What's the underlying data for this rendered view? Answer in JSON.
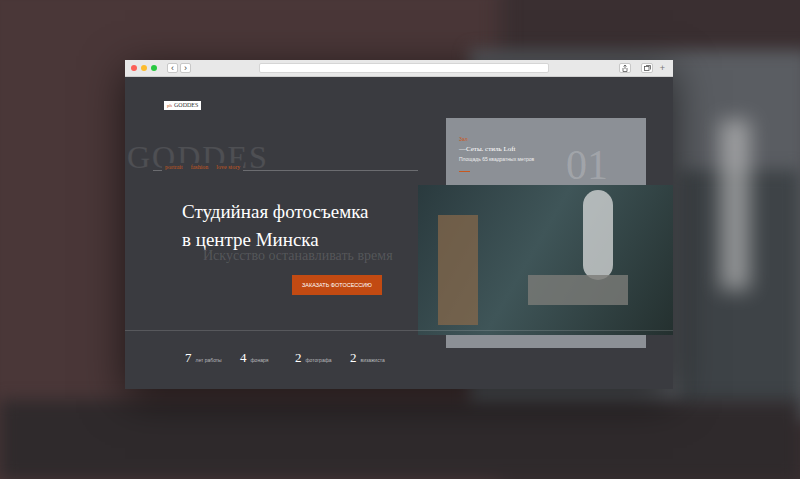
{
  "browser": {
    "back": "‹",
    "forward": "›",
    "new_tab": "+"
  },
  "site": {
    "logo_mark": "ph",
    "logo": "GODDES",
    "watermark": "GODDES",
    "nav": [
      {
        "label": "portrait"
      },
      {
        "label": "fashion"
      },
      {
        "label": "love story"
      }
    ],
    "headline_lines": [
      "Студийная фотосъемка",
      "в центре Минска"
    ],
    "tagline": "Искусство останавливать время",
    "cta": "ЗАКАЗАТЬ ФОТОСЕССИЮ",
    "feature": {
      "kicker": "Зал",
      "title": "—Сеты. стиль Loft",
      "detail": "Площадь 65 квадратных метров",
      "number": "01"
    },
    "stats": [
      {
        "value": "7",
        "label": "лет работы"
      },
      {
        "value": "4",
        "label": "фонаря"
      },
      {
        "value": "2",
        "label": "фотографа"
      },
      {
        "value": "2",
        "label": "визажиста"
      }
    ]
  }
}
